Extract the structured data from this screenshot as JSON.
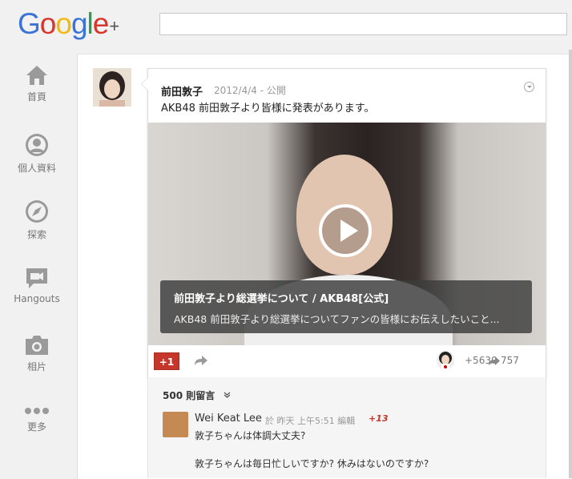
{
  "app": {
    "logo": {
      "g1": "G",
      "o1": "o",
      "o2": "o",
      "g2": "g",
      "l": "l",
      "e": "e",
      "plus": "+"
    }
  },
  "search": {
    "value": "",
    "placeholder": ""
  },
  "nav": {
    "items": [
      {
        "label": "首頁",
        "icon": "home-icon"
      },
      {
        "label": "個人資料",
        "icon": "profile-icon"
      },
      {
        "label": "探索",
        "icon": "compass-icon"
      },
      {
        "label": "Hangouts",
        "icon": "hangouts-icon"
      },
      {
        "label": "相片",
        "icon": "camera-icon"
      },
      {
        "label": "更多",
        "icon": "more-icon"
      }
    ]
  },
  "post": {
    "author": "前田敦子",
    "meta": "2012/4/4  -  公開",
    "text": "AKB48 前田敦子より皆様に発表があります。",
    "video": {
      "title": "前田敦子より総選挙について / AKB48[公式]",
      "description": "AKB48 前田敦子より総選挙についてファンの皆様にお伝えしたいこと..."
    },
    "actions": {
      "plusone": "+1",
      "plus_count": "+5630",
      "share_count": "757"
    }
  },
  "comments": {
    "count_label": "500 則留言",
    "items": [
      {
        "name": "Wei Keat Lee",
        "meta": "於 昨天 上午5:51 編輯",
        "plus": "+13",
        "line1": "敦子ちゃんは体調大丈夫?",
        "line2": "敦子ちゃんは毎日忙しいですか? 休みはないのですか?"
      }
    ]
  },
  "colors": {
    "brand_red": "#c6362b",
    "nav_gray": "#777777"
  }
}
